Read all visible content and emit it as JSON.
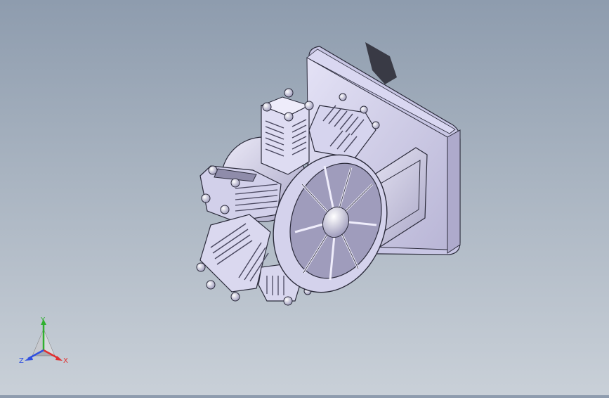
{
  "viewport": {
    "background_top": "#8e9cae",
    "background_bottom": "#c9d0d8",
    "part_color": "#d8d6f0",
    "edge_color": "#2a2a3a",
    "shadow_color": "#3a3a44"
  },
  "triad": {
    "x_label": "X",
    "y_label": "Y",
    "z_label": "Z",
    "x_color": "#e03030",
    "y_color": "#30b030",
    "z_color": "#3050e0"
  }
}
